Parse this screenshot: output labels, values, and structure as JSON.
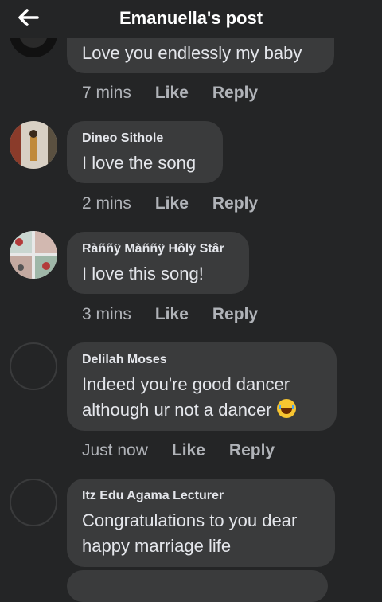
{
  "header": {
    "back_icon": "arrow-left-icon",
    "title": "Emanuella's post"
  },
  "comments": [
    {
      "name": "",
      "text": "Love you endlessly my baby",
      "time": "7 mins",
      "like": "Like",
      "reply": "Reply"
    },
    {
      "name": "Dineo Sithole",
      "text": "I love the song",
      "time": "2 mins",
      "like": "Like",
      "reply": "Reply"
    },
    {
      "name": "Ràññÿ Màññÿ Hôlÿ Stâr",
      "text": "I love this song!",
      "time": "3 mins",
      "like": "Like",
      "reply": "Reply"
    },
    {
      "name": "Delilah Moses",
      "text_line1": "Indeed you're good  dancer",
      "text_line2": "although ur not a dancer",
      "emoji": "rolling-on-floor-laughing-emoji",
      "time": "Just now",
      "like": "Like",
      "reply": "Reply"
    },
    {
      "name": "Itz Edu Agama Lecturer",
      "text_line1": "Congratulations to you dear",
      "text_line2": "happy marriage life"
    }
  ],
  "colors": {
    "background": "#242526",
    "bubble": "#3a3b3c",
    "text_primary": "#e4e6eb",
    "text_secondary": "#b0b3b8"
  }
}
